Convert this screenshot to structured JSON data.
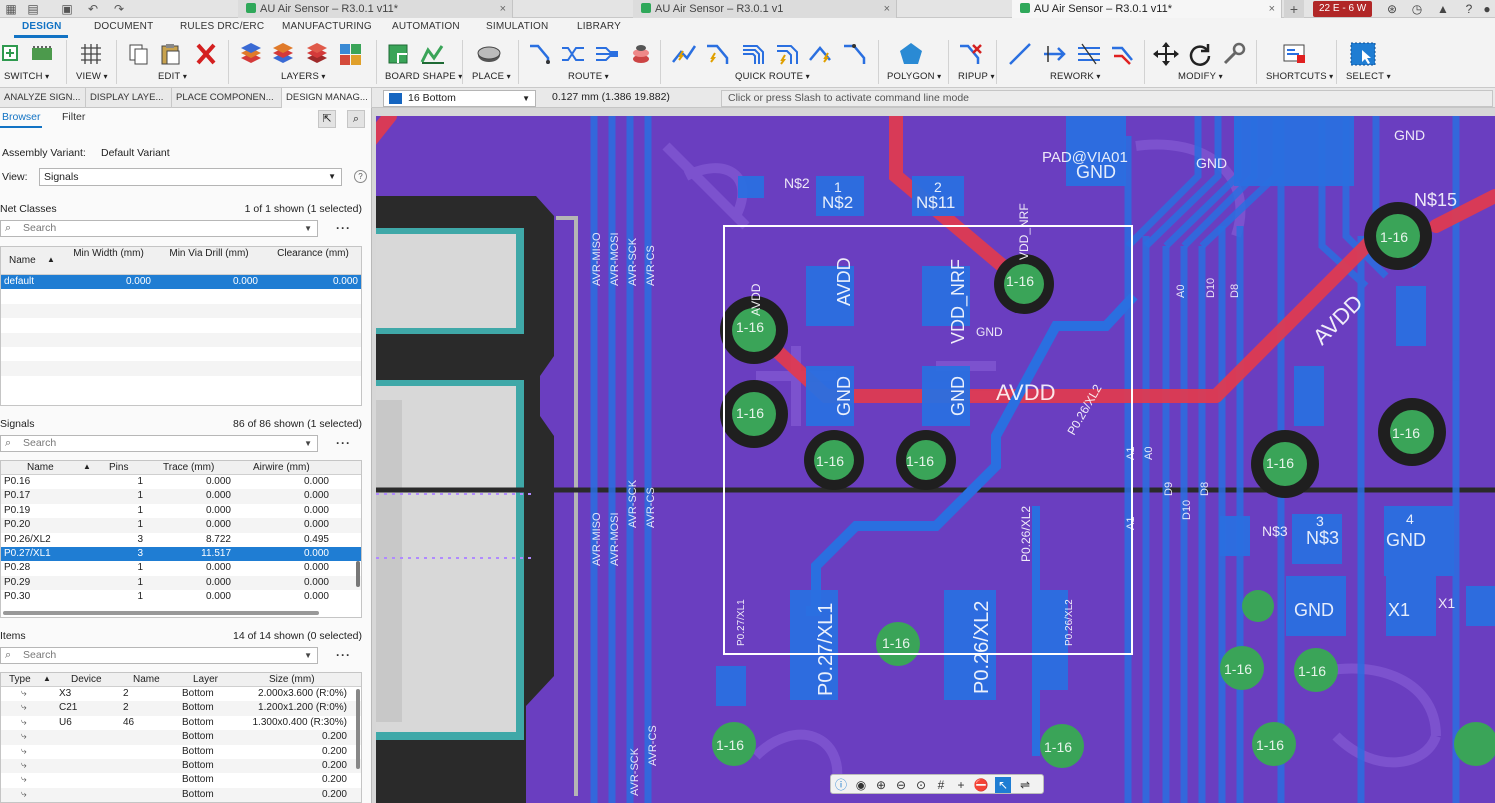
{
  "tabs": [
    {
      "label": "AU Air Sensor – R3.0.1 v11*",
      "close": "×"
    },
    {
      "label": "AU Air Sensor – R3.0.1 v1",
      "close": "×"
    },
    {
      "label": "AU Air Sensor – R3.0.1 v11*",
      "close": "×"
    }
  ],
  "job_badge": "22 E - 6 W",
  "ribbon": {
    "tabs": [
      "DESIGN",
      "DOCUMENT",
      "RULES DRC/ERC",
      "MANUFACTURING",
      "AUTOMATION",
      "SIMULATION",
      "LIBRARY"
    ],
    "groups": [
      "SWITCH",
      "VIEW",
      "EDIT",
      "LAYERS",
      "BOARD SHAPE",
      "PLACE",
      "ROUTE",
      "QUICK ROUTE",
      "POLYGON",
      "RIPUP",
      "REWORK",
      "MODIFY",
      "SHORTCUTS",
      "SELECT"
    ]
  },
  "panel_tabs": [
    "ANALYZE SIGN...",
    "DISPLAY LAYE...",
    "PLACE COMPONEN...",
    "DESIGN MANAG..."
  ],
  "layer": "16 Bottom",
  "coords": "0.127 mm (1.386 19.882)",
  "command_placeholder": "Click or press Slash to activate command line mode",
  "left": {
    "subtabs": [
      "Browser",
      "Filter"
    ],
    "assembly_label": "Assembly Variant:",
    "assembly_value": "Default Variant",
    "view_label": "View:",
    "view_value": "Signals",
    "net_classes": {
      "title": "Net Classes",
      "count": "1 of 1 shown (1 selected)",
      "search": "Search",
      "headers": [
        "Name",
        "Min Width (mm)",
        "Min Via Drill (mm)",
        "Clearance (mm)"
      ],
      "rows": [
        {
          "name": "default",
          "width": "0.000",
          "drill": "0.000",
          "clear": "0.000"
        }
      ]
    },
    "signals": {
      "title": "Signals",
      "count": "86 of 86 shown (1 selected)",
      "search": "Search",
      "headers": [
        "Name",
        "Pins",
        "Trace (mm)",
        "Airwire (mm)"
      ],
      "rows": [
        {
          "name": "P0.16",
          "pins": "1",
          "trace": "0.000",
          "air": "0.000"
        },
        {
          "name": "P0.17",
          "pins": "1",
          "trace": "0.000",
          "air": "0.000"
        },
        {
          "name": "P0.19",
          "pins": "1",
          "trace": "0.000",
          "air": "0.000"
        },
        {
          "name": "P0.20",
          "pins": "1",
          "trace": "0.000",
          "air": "0.000"
        },
        {
          "name": "P0.26/XL2",
          "pins": "3",
          "trace": "8.722",
          "air": "0.495"
        },
        {
          "name": "P0.27/XL1",
          "pins": "3",
          "trace": "11.517",
          "air": "0.000"
        },
        {
          "name": "P0.28",
          "pins": "1",
          "trace": "0.000",
          "air": "0.000"
        },
        {
          "name": "P0.29",
          "pins": "1",
          "trace": "0.000",
          "air": "0.000"
        },
        {
          "name": "P0.30",
          "pins": "1",
          "trace": "0.000",
          "air": "0.000"
        }
      ]
    },
    "items": {
      "title": "Items",
      "count": "14 of 14 shown (0 selected)",
      "search": "Search",
      "headers": [
        "Type",
        "Device",
        "Name",
        "Layer",
        "Size (mm)"
      ],
      "rows": [
        {
          "device": "X3",
          "name": "2",
          "layer": "Bottom",
          "size": "2.000x3.600 (R:0%)"
        },
        {
          "device": "C21",
          "name": "2",
          "layer": "Bottom",
          "size": "1.200x1.200 (R:0%)"
        },
        {
          "device": "U6",
          "name": "46",
          "layer": "Bottom",
          "size": "1.300x0.400 (R:30%)"
        },
        {
          "device": "",
          "name": "",
          "layer": "Bottom",
          "size": "0.200"
        },
        {
          "device": "",
          "name": "",
          "layer": "Bottom",
          "size": "0.200"
        },
        {
          "device": "",
          "name": "",
          "layer": "Bottom",
          "size": "0.200"
        },
        {
          "device": "",
          "name": "",
          "layer": "Bottom",
          "size": "0.200"
        },
        {
          "device": "",
          "name": "",
          "layer": "Bottom",
          "size": "0.200"
        }
      ]
    }
  },
  "pcb": {
    "labels": {
      "n2": "N$2",
      "n11": "N$11",
      "n3": "N$3",
      "n15": "N$15",
      "gnd": "GND",
      "avdd": "AVDD",
      "vddnrf": "VDD_NRF",
      "xl1": "P0.27/XL1",
      "xl2": "P0.26/XL2",
      "x1": "X1",
      "pad_via": "PAD@VIA01",
      "via": "1-16",
      "avr_miso": "AVR-MISO",
      "avr_mosi": "AVR-MOSI",
      "avr_sck": "AVR-SCK",
      "avr_cs": "AVR-CS",
      "a0": "A0",
      "a1": "A1",
      "d8": "D8",
      "d9": "D9",
      "d10": "D10",
      "one": "1",
      "two": "2",
      "three": "3",
      "four": "4"
    }
  },
  "colors": {
    "board": "#6a3ec0",
    "bottom_copper": "#2a6fe0",
    "top_copper": "#e23a4e",
    "via_ring": "#3aa458",
    "selection": "#1f7dd3"
  }
}
